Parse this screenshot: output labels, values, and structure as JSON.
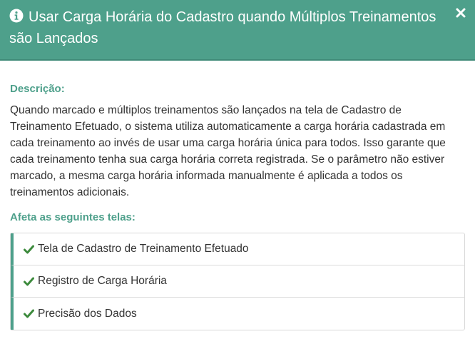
{
  "header": {
    "title": "Usar Carga Horária do Cadastro quando Múltiplos Treinamentos são Lançados",
    "info_icon": "info-circle-icon",
    "close_icon": "close-icon"
  },
  "description": {
    "label": "Descrição:",
    "text": "Quando marcado e múltiplos treinamentos são lançados na tela de Cadastro de Treinamento Efetuado, o sistema utiliza automaticamente a carga horária cadastrada em cada treinamento ao invés de usar uma carga horária única para todos. Isso garante que cada treinamento tenha sua carga horária correta registrada. Se o parâmetro não estiver marcado, a mesma carga horária informada manualmente é aplicada a todos os treinamentos adicionais."
  },
  "affects": {
    "label": "Afeta as seguintes telas:",
    "items": [
      {
        "label": "Tela de Cadastro de Treinamento Efetuado",
        "icon": "check-icon"
      },
      {
        "label": "Registro de Carga Horária",
        "icon": "check-icon"
      },
      {
        "label": "Precisão dos Dados",
        "icon": "check-icon"
      }
    ]
  },
  "colors": {
    "accent": "#4ea08b",
    "check": "#3c8a3c",
    "text": "#333333"
  }
}
